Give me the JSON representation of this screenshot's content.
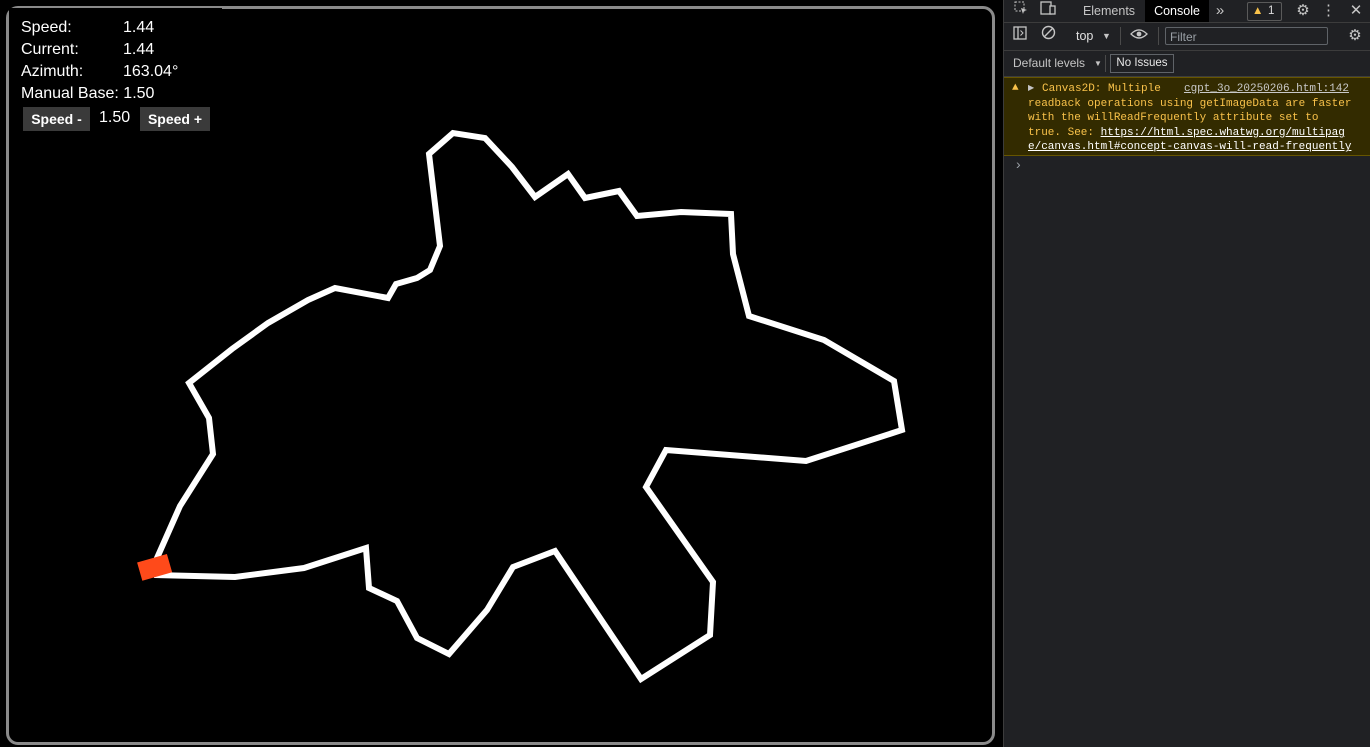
{
  "hud": {
    "speed_label": "Speed:",
    "speed_value": "1.44",
    "current_label": "Current:",
    "current_value": "1.44",
    "azimuth_label": "Azimuth:",
    "azimuth_value": "163.04°",
    "manual_base_label": "Manual Base:",
    "manual_base_value": "1.50",
    "speed_minus_label": "Speed -",
    "speed_display": "1.50",
    "speed_plus_label": "Speed +"
  },
  "colors": {
    "track": "#ffffff",
    "car": "#ff4a1a",
    "canvas_bg": "#000000",
    "frame": "#8a8a8a",
    "warning_bg": "#332b00",
    "warning_text": "#f9c24a"
  },
  "devtools": {
    "tabs": [
      "Elements",
      "Console"
    ],
    "active_tab": "Console",
    "more_tabs_icon": "chevron-double-right-icon",
    "warning_count": "1",
    "context_selector": "top",
    "filter_placeholder": "Filter",
    "levels_label": "Default levels",
    "issues_label": "No Issues",
    "message": {
      "source": "cgpt_3o_20250206.html:142",
      "line1": "Canvas2D: Multiple",
      "line2": "readback operations using getImageData are faster",
      "line3": "with the willReadFrequently attribute set to",
      "line4_prefix": "true. See: ",
      "link_part1": "https://html.spec.whatwg.org/multipag",
      "link_part2": "e/canvas.html#concept-canvas-will-read-frequently"
    },
    "prompt_symbol": "›"
  }
}
